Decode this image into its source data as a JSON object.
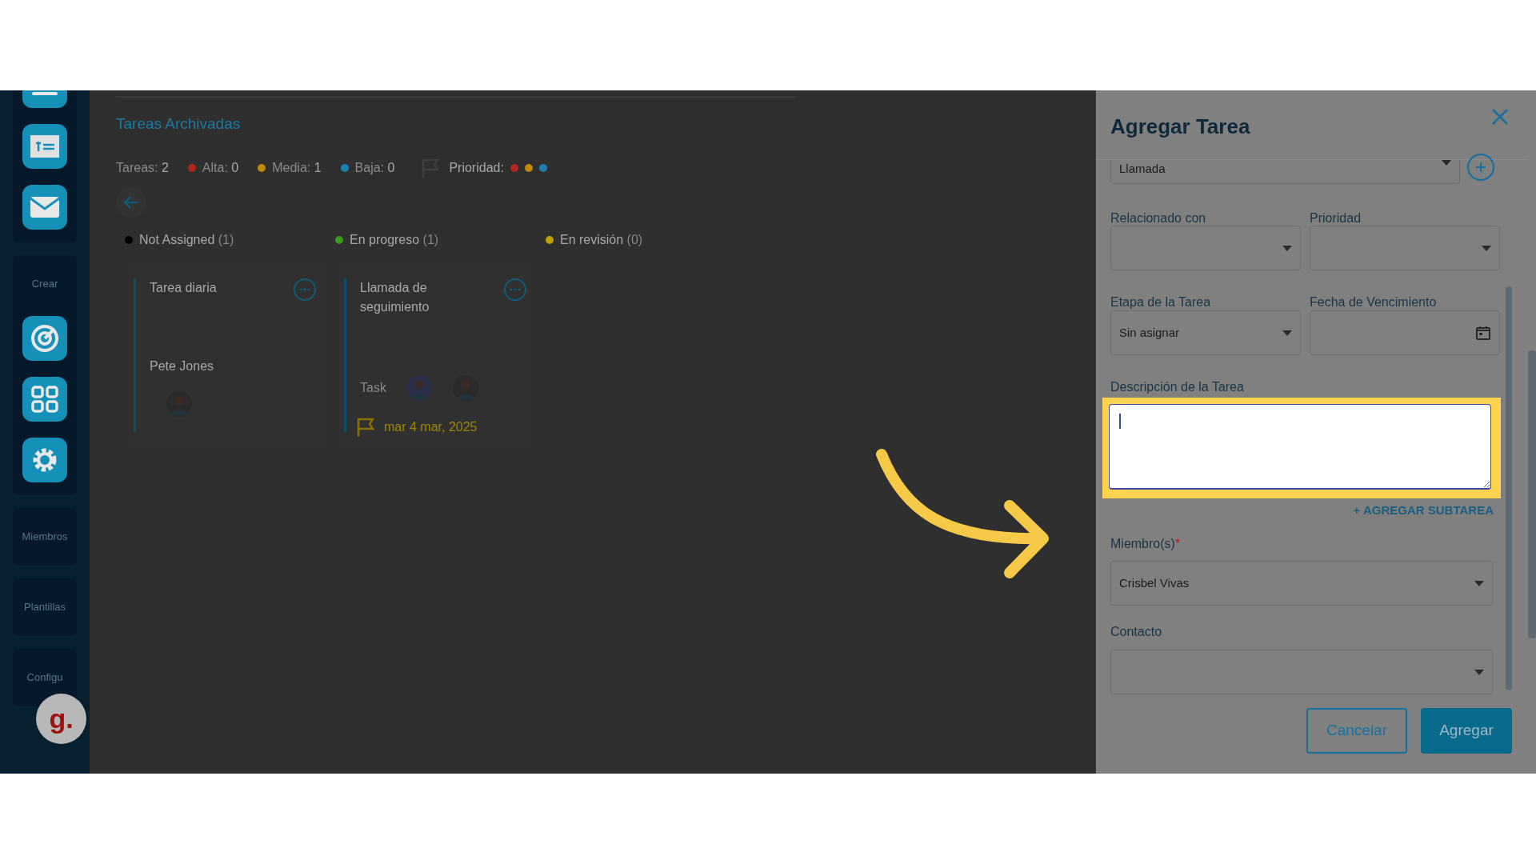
{
  "sidebar": {
    "labels": [
      "Crear",
      "Miembros",
      "Plantillas",
      "Configu"
    ],
    "avatar": "g."
  },
  "board": {
    "title": "Tareas Archivadas",
    "stats": [
      {
        "label": "Tareas:",
        "value": "2"
      },
      {
        "label": "Alta:",
        "value": "0",
        "color": "#b3261e"
      },
      {
        "label": "Media:",
        "value": "1",
        "color": "#c08a00"
      },
      {
        "label": "Baja:",
        "value": "0",
        "color": "#1b7fb0"
      }
    ],
    "priority": {
      "label": "Prioridad:",
      "levels": [
        {
          "color": "#b3261e"
        },
        {
          "color": "#c08a00"
        },
        {
          "color": "#1b7fb0"
        }
      ]
    },
    "columns": [
      {
        "name": "Not Assigned",
        "count": "(1)",
        "color": "#000000"
      },
      {
        "name": "En progreso",
        "count": "(1)",
        "color": "#3a9a1a"
      },
      {
        "name": "En revisión",
        "count": "(0)",
        "color": "#c0a000"
      }
    ],
    "cards": [
      {
        "title": "Tarea diaria",
        "assignee": "Pete Jones"
      },
      {
        "title": "Llamada de seguimiento",
        "type": "Task",
        "date": "mar 4 mar, 2025"
      }
    ]
  },
  "panel": {
    "title": "Agregar Tarea",
    "type_value": "Llamada",
    "fields": [
      {
        "label": "Relacionado con",
        "kind": "select"
      },
      {
        "label": "Prioridad",
        "kind": "select"
      },
      {
        "label": "Etapa de la Tarea",
        "value": "Sin asignar",
        "kind": "select"
      },
      {
        "label": "Fecha de Vencimiento",
        "kind": "date"
      }
    ],
    "description_label": "Descripción de la Tarea",
    "subtask_link": "+ AGREGAR SUBTAREA",
    "members_label": "Miembro(s)",
    "members_required": "*",
    "members_value": "Crisbel Vivas",
    "contact_label": "Contacto",
    "buttons": [
      {
        "label": "Cancelar",
        "kind": "outline"
      },
      {
        "label": "Agregar",
        "kind": "primary"
      }
    ]
  }
}
